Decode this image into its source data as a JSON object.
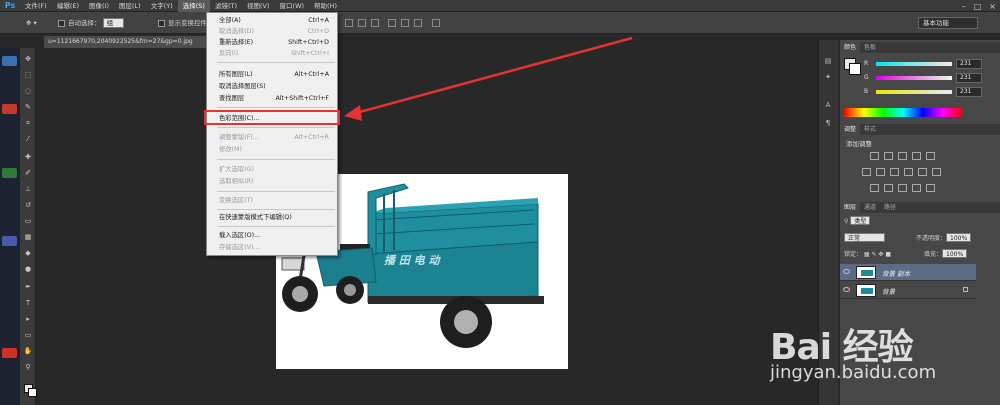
{
  "app": {
    "logo": "Ps"
  },
  "menubar": {
    "items": [
      "文件(F)",
      "编辑(E)",
      "图像(I)",
      "图层(L)",
      "文字(Y)",
      "选择(S)",
      "滤镜(T)",
      "视图(V)",
      "窗口(W)",
      "帮助(H)"
    ],
    "active_index": 5,
    "window_controls": [
      "–",
      "□",
      "×"
    ]
  },
  "options_bar": {
    "auto_select_label": "自动选择：",
    "auto_select_value": "组",
    "show_transform_label": "显示变换控件",
    "workspace": "基本功能"
  },
  "document": {
    "tab_title": "u=1121667970,2040922525&fm=27&gp=0.jpg"
  },
  "select_menu": {
    "items": [
      {
        "label": "全部(A)",
        "shortcut": "Ctrl+A",
        "enabled": true
      },
      {
        "label": "取消选择(D)",
        "shortcut": "Ctrl+D",
        "enabled": false
      },
      {
        "label": "重新选择(E)",
        "shortcut": "Shift+Ctrl+D",
        "enabled": true
      },
      {
        "label": "反向(I)",
        "shortcut": "Shift+Ctrl+I",
        "enabled": false
      },
      {
        "label": "所有图层(L)",
        "shortcut": "Alt+Ctrl+A",
        "enabled": true
      },
      {
        "label": "取消选择图层(S)",
        "shortcut": "",
        "enabled": true
      },
      {
        "label": "查找图层",
        "shortcut": "Alt+Shift+Ctrl+F",
        "enabled": true
      },
      {
        "label": "色彩范围(C)...",
        "shortcut": "",
        "enabled": true,
        "highlighted": true
      },
      {
        "label": "调整蒙版(F)...",
        "shortcut": "Alt+Ctrl+R",
        "enabled": false
      },
      {
        "label": "修改(M)",
        "shortcut": "",
        "enabled": false
      },
      {
        "label": "扩大选取(G)",
        "shortcut": "",
        "enabled": false
      },
      {
        "label": "选取相似(R)",
        "shortcut": "",
        "enabled": false
      },
      {
        "label": "变换选区(T)",
        "shortcut": "",
        "enabled": false
      },
      {
        "label": "在快速蒙版模式下编辑(Q)",
        "shortcut": "",
        "enabled": true
      },
      {
        "label": "载入选区(O)...",
        "shortcut": "",
        "enabled": true
      },
      {
        "label": "存储选区(V)...",
        "shortcut": "",
        "enabled": false
      }
    ],
    "highlight_color": "#e53232"
  },
  "panels": {
    "color_tabs": [
      "颜色",
      "色板"
    ],
    "rgb": [
      {
        "channel": "R",
        "value": "231"
      },
      {
        "channel": "G",
        "value": "231"
      },
      {
        "channel": "B",
        "value": "231"
      }
    ],
    "adjust_tabs": [
      "调整",
      "样式"
    ],
    "adjust_title": "添加调整",
    "layer_tabs": [
      "图层",
      "通道",
      "路径"
    ],
    "filter_kind": "类型",
    "blend_mode": "正常",
    "opacity_label": "不透明度：",
    "opacity": "100%",
    "lock_label": "锁定：",
    "fill_label": "填充：",
    "fill": "100%",
    "layers": [
      {
        "name": "背景 副本",
        "selected": true
      },
      {
        "name": "背景",
        "selected": false
      }
    ]
  },
  "canvas_image": {
    "vehicle_text": "播 田 电 动",
    "vehicle_color": "#1f8fa0"
  },
  "watermark": {
    "logo": "Bai  经验",
    "url": "jingyan.baidu.com"
  }
}
